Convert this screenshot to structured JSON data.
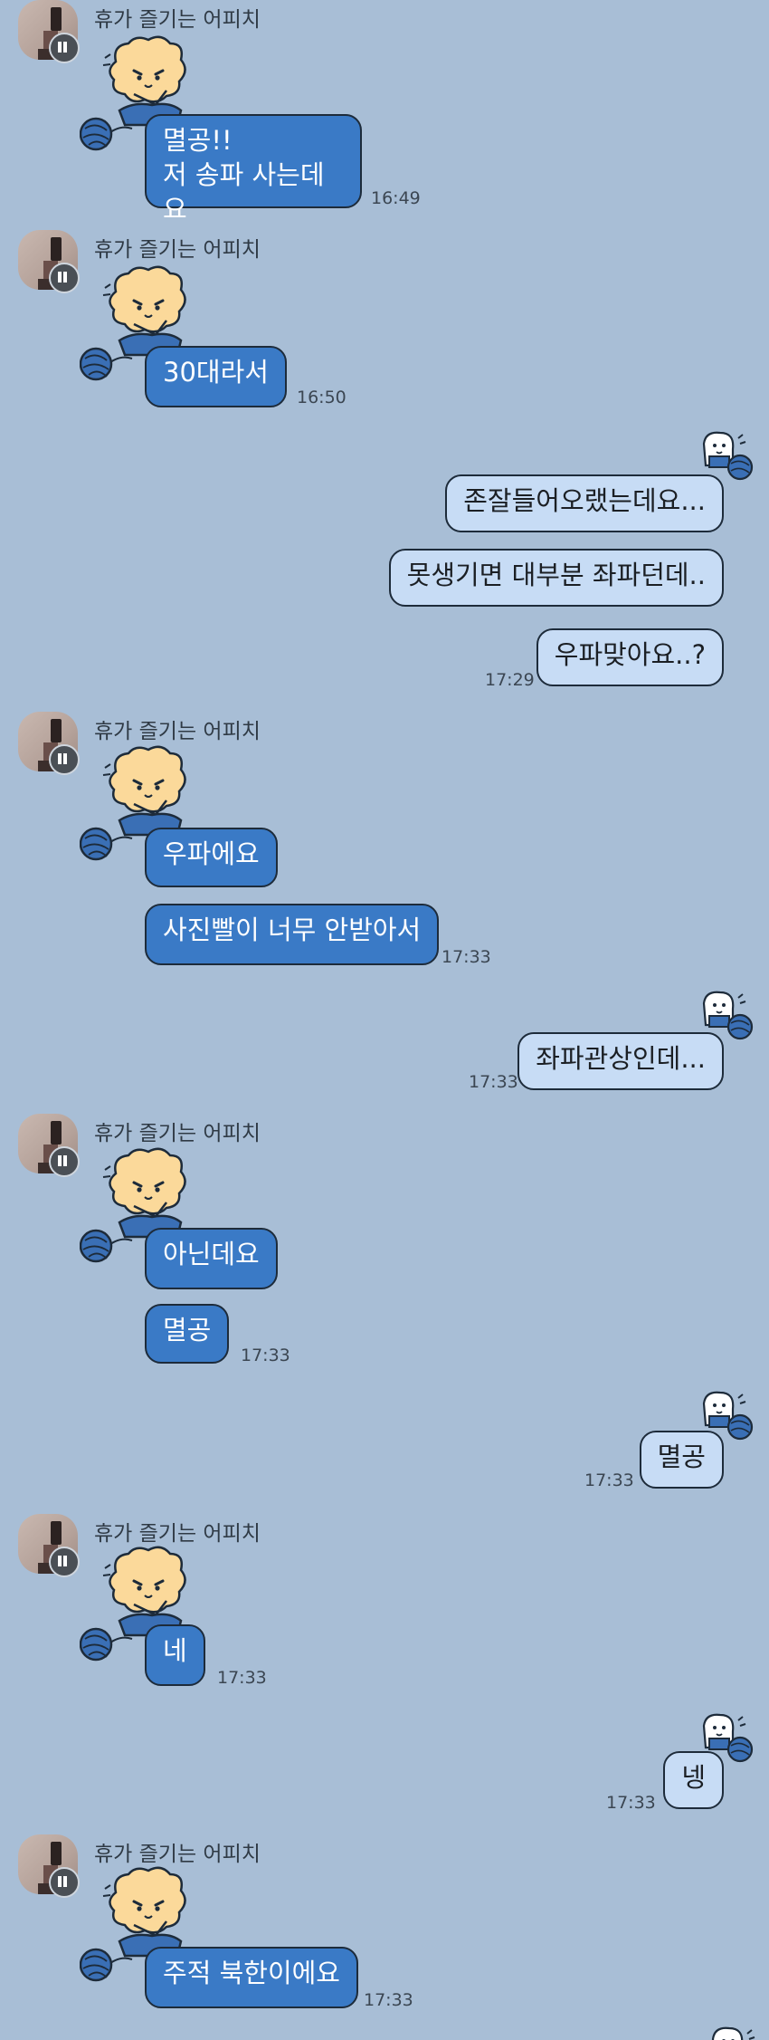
{
  "sender_name": "휴가 즐기는 어피치",
  "colors": {
    "background": "#a8bed6",
    "incoming_bubble": "#3a7ac6",
    "outgoing_bubble": "#c7dcf5"
  },
  "messages": [
    {
      "side": "in",
      "text": "멸공!!\n저 송파 사는데요",
      "time": "16:49"
    },
    {
      "side": "in",
      "text": "30대라서",
      "time": "16:50"
    },
    {
      "side": "out",
      "text": "존잘들어오랬는데요..."
    },
    {
      "side": "out",
      "text": "못생기면 대부분 좌파던데.."
    },
    {
      "side": "out",
      "text": "우파맞아요..?",
      "time": "17:29"
    },
    {
      "side": "in",
      "text": "우파에요"
    },
    {
      "side": "in",
      "text": "사진빨이 너무 안받아서",
      "time": "17:33"
    },
    {
      "side": "out",
      "text": "좌파관상인데...",
      "time": "17:33"
    },
    {
      "side": "in",
      "text": "아닌데요"
    },
    {
      "side": "in",
      "text": "멸공",
      "time": "17:33"
    },
    {
      "side": "out",
      "text": "멸공",
      "time": "17:33"
    },
    {
      "side": "in",
      "text": "네",
      "time": "17:33"
    },
    {
      "side": "out",
      "text": "넹",
      "time": "17:33"
    },
    {
      "side": "in",
      "text": "주적 북한이에요",
      "time": "17:33"
    }
  ]
}
